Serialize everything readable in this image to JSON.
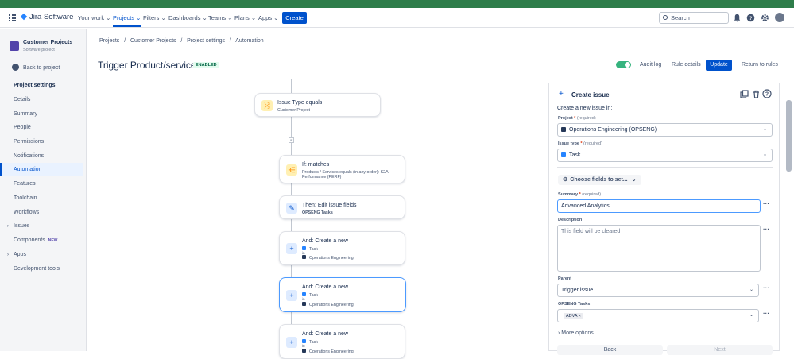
{
  "nav": {
    "logo": "Jira Software",
    "items": [
      "Your work ⌄",
      "Projects ⌄",
      "Filters ⌄",
      "Dashboards ⌄",
      "Teams ⌄",
      "Plans ⌄",
      "Apps ⌄"
    ],
    "create": "Create",
    "search_placeholder": "Search"
  },
  "sidebar": {
    "project_name": "Customer Projects",
    "project_sub": "Software project",
    "back": "Back to project",
    "items": [
      {
        "label": "Project settings"
      },
      {
        "label": "Details"
      },
      {
        "label": "Summary"
      },
      {
        "label": "People"
      },
      {
        "label": "Permissions"
      },
      {
        "label": "Notifications"
      },
      {
        "label": "Automation"
      },
      {
        "label": "Features"
      },
      {
        "label": "Toolchain"
      },
      {
        "label": "Workflows"
      },
      {
        "label": "Issues"
      },
      {
        "label": "Components",
        "badge": "NEW"
      },
      {
        "label": "Apps"
      },
      {
        "label": "Development tools"
      }
    ]
  },
  "breadcrumb": [
    "Projects",
    "Customer Projects",
    "Project settings",
    "Automation"
  ],
  "rule": {
    "title": "Trigger Product/services",
    "status": "ENABLED",
    "audit_log": "Audit log",
    "rule_details": "Rule details",
    "update": "Update",
    "return": "Return to rules"
  },
  "flow": {
    "trigger": {
      "title": "Issue Type equals",
      "sub": "Customer Project"
    },
    "if_badge": "IF",
    "condition": {
      "title": "If: matches",
      "sub1": "Products / Services equals (in any order): S2A",
      "sub2": "Performance (PERF)"
    },
    "edit": {
      "title": "Then: Edit issue fields",
      "sub": "OPSENG Tasks"
    },
    "create_cards": [
      {
        "title": "And: Create a new",
        "type": "Task",
        "in": "in",
        "project": "Operations Engineering"
      },
      {
        "title": "And: Create a new",
        "type": "Task",
        "in": "in",
        "project": "Operations Engineering"
      },
      {
        "title": "And: Create a new",
        "type": "Task",
        "in": "in",
        "project": "Operations Engineering"
      }
    ]
  },
  "panel": {
    "header": "Create issue",
    "intro": "Create a new issue in:",
    "project_label": "Project",
    "required": "(required)",
    "project_value": "Operations Engineering (OPSENG)",
    "issuetype_label": "Issue type",
    "issuetype_value": "Task",
    "choose_fields": "Choose fields to set...",
    "summary_label": "Summary",
    "summary_value": "Advanced Analytics",
    "description_label": "Description",
    "description_placeholder": "This field will be cleared",
    "parent_label": "Parent",
    "parent_value": "Trigger issue",
    "opseng_label": "OPSENG Tasks",
    "opseng_chip": "ADVA",
    "more_options": "More options",
    "back": "Back",
    "next": "Next"
  }
}
